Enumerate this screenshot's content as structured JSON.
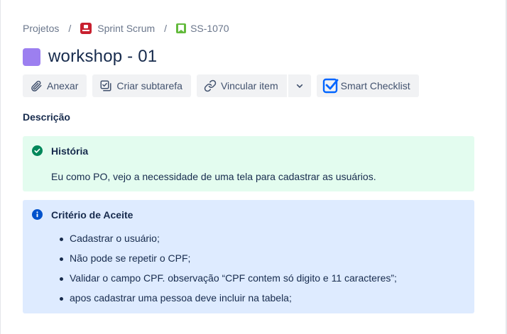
{
  "breadcrumb": {
    "projects": "Projetos",
    "separator": "/",
    "project": "Sprint Scrum",
    "issue_key": "SS-1070"
  },
  "issue": {
    "type_color": "#9c7ff0",
    "title": "workshop - 01"
  },
  "toolbar": {
    "attach": "Anexar",
    "create_subtask": "Criar subtarefa",
    "link_item": "Vincular item",
    "smart_checklist": "Smart Checklist"
  },
  "description": {
    "label": "Descrição",
    "story_panel": {
      "title": "História",
      "text": "Eu como PO, vejo a necessidade de uma tela para cadastrar as usuários.",
      "color": "#e3fcef"
    },
    "acceptance_panel": {
      "title": "Critério de Aceite",
      "color": "#deebff",
      "items": [
        "Cadastrar o usuário;",
        "Não pode se repetir o CPF;",
        "Validar o campo CPF. observação “CPF contem só digito e 11 caracteres”;",
        "apos cadastrar uma pessoa deve incluir na tabela;"
      ]
    }
  },
  "icons": {
    "project": "project-avatar-icon",
    "issue_key": "story-bookmark-icon",
    "attach": "paperclip-icon",
    "subtask": "subtask-icon",
    "link": "link-icon",
    "more": "chevron-down-icon",
    "checklist": "checkbox-checked-icon",
    "success": "check-circle-icon",
    "info": "info-circle-icon"
  }
}
